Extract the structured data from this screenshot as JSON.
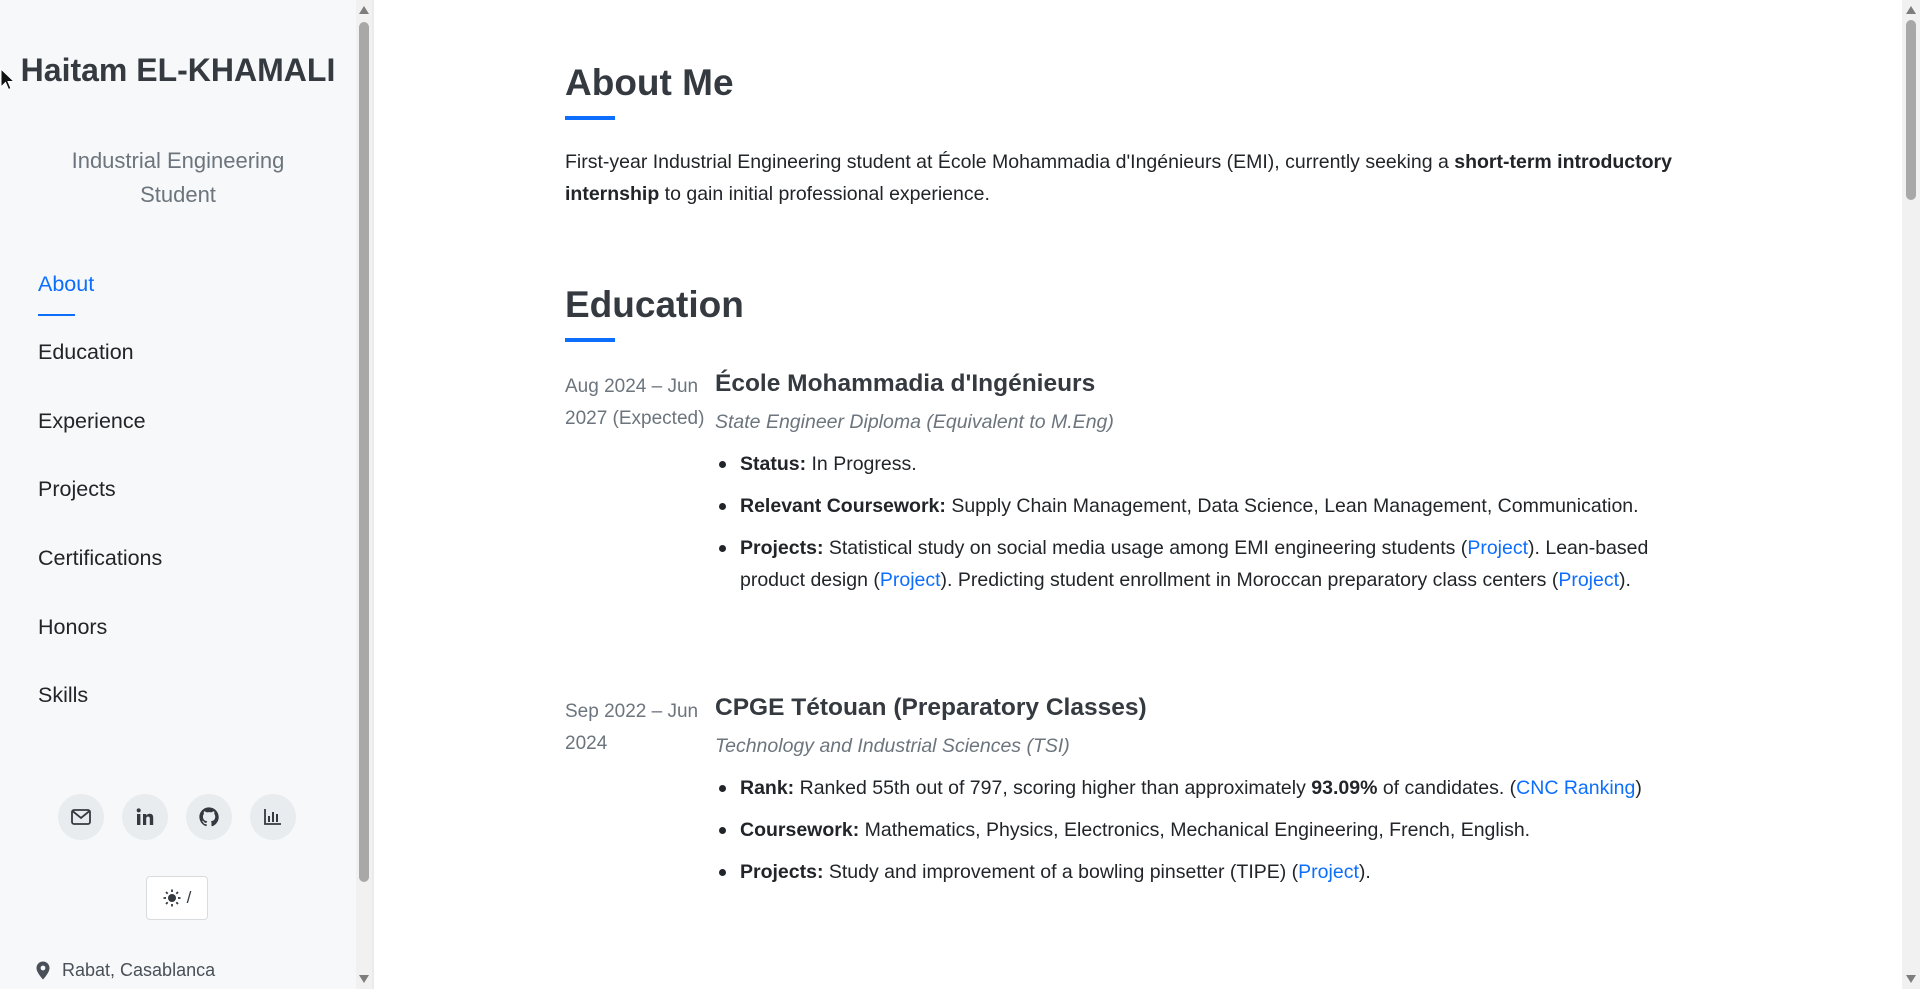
{
  "sidebar": {
    "name": "Haitam EL-KHAMALI",
    "title": "Industrial Engineering Student",
    "nav": [
      {
        "label": "About",
        "active": true
      },
      {
        "label": "Education",
        "active": false
      },
      {
        "label": "Experience",
        "active": false
      },
      {
        "label": "Projects",
        "active": false
      },
      {
        "label": "Certifications",
        "active": false
      },
      {
        "label": "Honors",
        "active": false
      },
      {
        "label": "Skills",
        "active": false
      }
    ],
    "socials": [
      "mail-icon",
      "linkedin-icon",
      "github-icon",
      "chart-icon"
    ],
    "theme_toggle": {
      "icon": "sun-icon",
      "separator": "/"
    },
    "location": "Rabat, Casablanca"
  },
  "about": {
    "heading": "About Me",
    "text_before": "First-year Industrial Engineering student at École Mohammadia d'Ingénieurs (EMI), currently seeking a ",
    "text_bold": "short-term introductory internship",
    "text_after": " to gain initial professional experience."
  },
  "education": {
    "heading": "Education",
    "entries": [
      {
        "date": "Aug 2024 – Jun 2027 (Expected)",
        "school": "École Mohammadia d'Ingénieurs",
        "degree": "State Engineer Diploma (Equivalent to M.Eng)",
        "status_label": "Status:",
        "status_text": " In Progress.",
        "coursework_label": "Relevant Coursework:",
        "coursework_text": " Supply Chain Management, Data Science, Lean Management, Communication.",
        "projects_label": "Projects:",
        "projects_text_1": " Statistical study on social media usage among EMI engineering students (",
        "project_link": "Project",
        "projects_text_2": "). Lean-based product design (",
        "projects_text_3": "). Predicting student enrollment in Moroccan preparatory class centers (",
        "projects_text_4": ")."
      },
      {
        "date": "Sep 2022 – Jun 2024",
        "school": "CPGE Tétouan (Preparatory Classes)",
        "degree": "Technology and Industrial Sciences (TSI)",
        "rank_label": "Rank:",
        "rank_text_1": " Ranked 55th out of 797, scoring higher than approximately ",
        "rank_bold": "93.09%",
        "rank_text_2": " of candidates. (",
        "rank_link": "CNC Ranking",
        "rank_text_3": ")",
        "coursework_label": "Coursework:",
        "coursework_text": " Mathematics, Physics, Electronics, Mechanical Engineering, French, English.",
        "projects_label": "Projects:",
        "projects_text_1": " Study and improvement of a bowling pinsetter (TIPE) (",
        "project_link": "Project",
        "projects_text_2": ")."
      }
    ]
  }
}
